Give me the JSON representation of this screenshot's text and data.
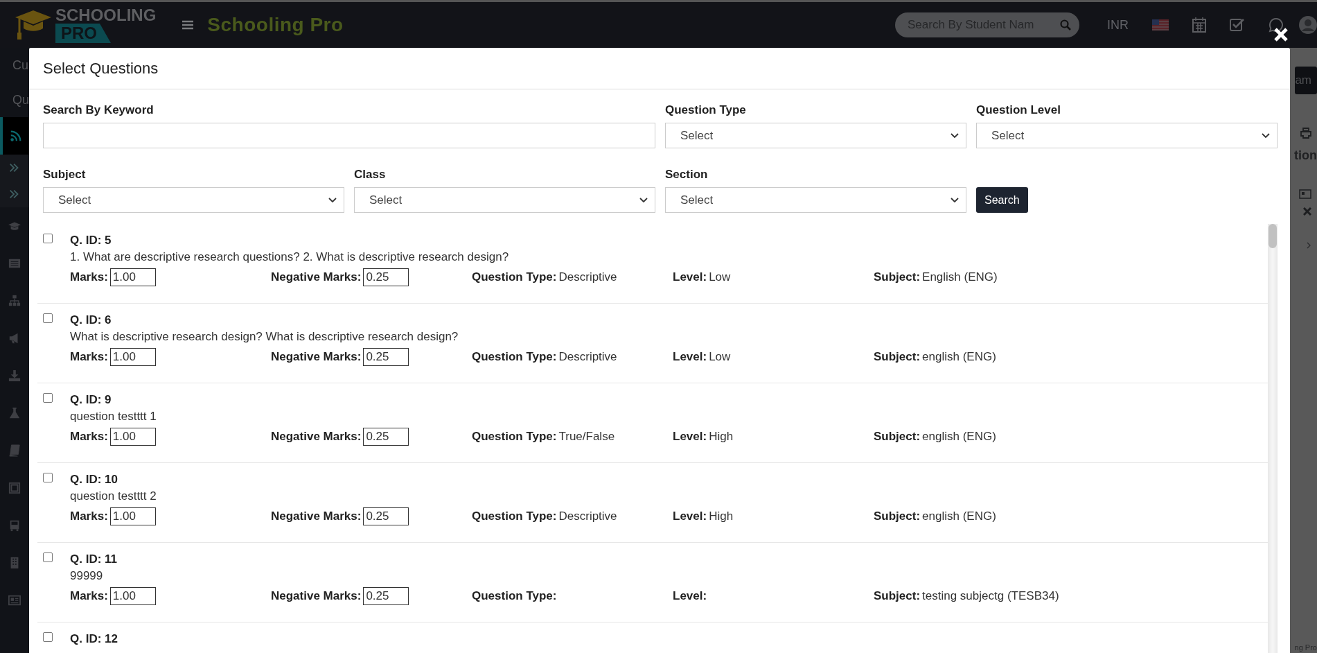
{
  "header": {
    "logo": {
      "line_1": "SCHOOLING",
      "line_2": "PRO"
    },
    "title": "Schooling Pro",
    "search": {
      "placeholder": "Search By Student Nam"
    },
    "currency": "INR"
  },
  "background": {
    "sidebar_texts": [
      "Cu",
      "Qu"
    ],
    "button": "am",
    "heading": "tion",
    "footer": "ng Pro"
  },
  "sidebar": {
    "items": [
      {
        "kind": "feed",
        "selected": true
      },
      {
        "kind": "sub",
        "selected": false
      },
      {
        "kind": "sub",
        "selected": false
      },
      {
        "kind": "cap",
        "selected": false
      },
      {
        "kind": "list",
        "selected": false
      },
      {
        "kind": "tree",
        "selected": false
      },
      {
        "kind": "horn",
        "selected": false
      },
      {
        "kind": "download",
        "selected": false
      },
      {
        "kind": "flask",
        "selected": false
      },
      {
        "kind": "book",
        "selected": false
      },
      {
        "kind": "frame",
        "selected": false
      },
      {
        "kind": "bus",
        "selected": false
      },
      {
        "kind": "building",
        "selected": false
      },
      {
        "kind": "news",
        "selected": false
      }
    ]
  },
  "modal": {
    "title": "Select Questions",
    "filters": [
      {
        "kind": "text",
        "label": "Search By Keyword"
      },
      {
        "kind": "select",
        "label": "Question Type",
        "value": "Select"
      },
      {
        "kind": "select",
        "label": "Question Level",
        "value": "Select"
      },
      {
        "kind": "select",
        "label": "Subject",
        "value": "Select"
      },
      {
        "kind": "select",
        "label": "Class",
        "value": "Select"
      },
      {
        "kind": "select",
        "label": "Section",
        "value": "Select"
      }
    ],
    "search_button": "Search",
    "questions": [
      {
        "id_label": "Q. ID: 5",
        "checked": false,
        "text": "1. What are descriptive research questions? 2. What is descriptive research design?",
        "marks_label": "Marks:",
        "marks": "1.00",
        "negative_label": "Negative Marks:",
        "negative": "0.25",
        "type_label": "Question Type:",
        "type": "Descriptive",
        "level_label": "Level:",
        "question_level": "Low",
        "subject_label": "Subject:",
        "subject": "English (ENG)"
      },
      {
        "id_label": "Q. ID: 6",
        "checked": false,
        "text": "What is descriptive research design? What is descriptive research design?",
        "marks_label": "Marks:",
        "marks": "1.00",
        "negative_label": "Negative Marks:",
        "negative": "0.25",
        "type_label": "Question Type:",
        "type": "Descriptive",
        "level_label": "Level:",
        "question_level": "Low",
        "subject_label": "Subject:",
        "subject": "english (ENG)"
      },
      {
        "id_label": "Q. ID: 9",
        "checked": false,
        "text": "question testttt 1",
        "marks_label": "Marks:",
        "marks": "1.00",
        "negative_label": "Negative Marks:",
        "negative": "0.25",
        "type_label": "Question Type:",
        "type": "True/False",
        "level_label": "Level:",
        "question_level": "High",
        "subject_label": "Subject:",
        "subject": "english (ENG)"
      },
      {
        "id_label": "Q. ID: 10",
        "checked": false,
        "text": "question testttt 2",
        "marks_label": "Marks:",
        "marks": "1.00",
        "negative_label": "Negative Marks:",
        "negative": "0.25",
        "type_label": "Question Type:",
        "type": "Descriptive",
        "level_label": "Level:",
        "question_level": "High",
        "subject_label": "Subject:",
        "subject": "english (ENG)"
      },
      {
        "id_label": "Q. ID: 11",
        "checked": false,
        "text": "99999",
        "marks_label": "Marks:",
        "marks": "1.00",
        "negative_label": "Negative Marks:",
        "negative": "0.25",
        "type_label": "Question Type:",
        "level_label": "Level:",
        "subject_label": "Subject:",
        "subject": "testing subjectg (TESB34)"
      },
      {
        "id_label": "Q. ID: 12",
        "checked": false
      }
    ]
  }
}
